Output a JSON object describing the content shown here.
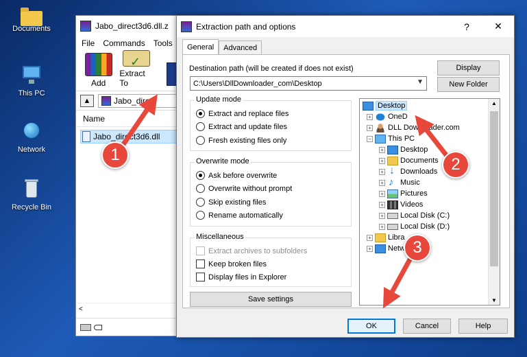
{
  "desktop": {
    "icons": [
      {
        "label": "Documents",
        "icon": "folder-icon"
      },
      {
        "label": "This PC",
        "icon": "computer-icon"
      },
      {
        "label": "Network",
        "icon": "network-icon"
      },
      {
        "label": "Recycle Bin",
        "icon": "recycle-bin-icon"
      }
    ]
  },
  "winrar": {
    "title": "Jabo_direct3d6.dll.z",
    "menu": [
      "File",
      "Commands",
      "Tools"
    ],
    "toolbar": {
      "add_label": "Add",
      "extract_label": "Extract To"
    },
    "address": "Jabo_direc",
    "column_name": "Name",
    "file_name": "Jabo_direct3d6.dll",
    "scroll_left": "<"
  },
  "dialog": {
    "title": "Extraction path and options",
    "help": "?",
    "close": "✕",
    "tabs": [
      "General",
      "Advanced"
    ],
    "dest_label": "Destination path (will be created if does not exist)",
    "dest_value": "C:\\Users\\DllDownloader_com\\Desktop",
    "display_button": "Display",
    "new_folder_button": "New Folder",
    "update_mode": {
      "title": "Update mode",
      "options": [
        "Extract and replace files",
        "Extract and update files",
        "Fresh existing files only"
      ],
      "selected": 0
    },
    "overwrite_mode": {
      "title": "Overwrite mode",
      "options": [
        "Ask before overwrite",
        "Overwrite without prompt",
        "Skip existing files",
        "Rename automatically"
      ],
      "selected": 0
    },
    "misc": {
      "title": "Miscellaneous",
      "options": [
        "Extract archives to subfolders",
        "Keep broken files",
        "Display files in Explorer"
      ]
    },
    "save_settings": "Save settings",
    "tree": [
      {
        "label": "Desktop",
        "icon": "desktop-icon"
      },
      {
        "label": "OneD",
        "icon": "onedrive-icon"
      },
      {
        "label": "DLL Downloader.com",
        "icon": "user-folder-icon"
      },
      {
        "label": "This PC",
        "icon": "computer-icon"
      },
      {
        "label": "Desktop",
        "icon": "desktop-icon"
      },
      {
        "label": "Documents",
        "icon": "folder-icon"
      },
      {
        "label": "Downloads",
        "icon": "download-icon"
      },
      {
        "label": "Music",
        "icon": "music-icon"
      },
      {
        "label": "Pictures",
        "icon": "pictures-icon"
      },
      {
        "label": "Videos",
        "icon": "videos-icon"
      },
      {
        "label": "Local Disk (C:)",
        "icon": "drive-icon"
      },
      {
        "label": "Local Disk (D:)",
        "icon": "drive-icon"
      },
      {
        "label": "Libra",
        "icon": "libraries-icon"
      },
      {
        "label": "Netw",
        "icon": "network-icon"
      }
    ],
    "ok_button": "OK",
    "cancel_button": "Cancel",
    "help_button": "Help"
  },
  "annotations": [
    "1",
    "2",
    "3"
  ],
  "colors": {
    "arrow": "#e8473b",
    "accent": "#0078d7"
  }
}
